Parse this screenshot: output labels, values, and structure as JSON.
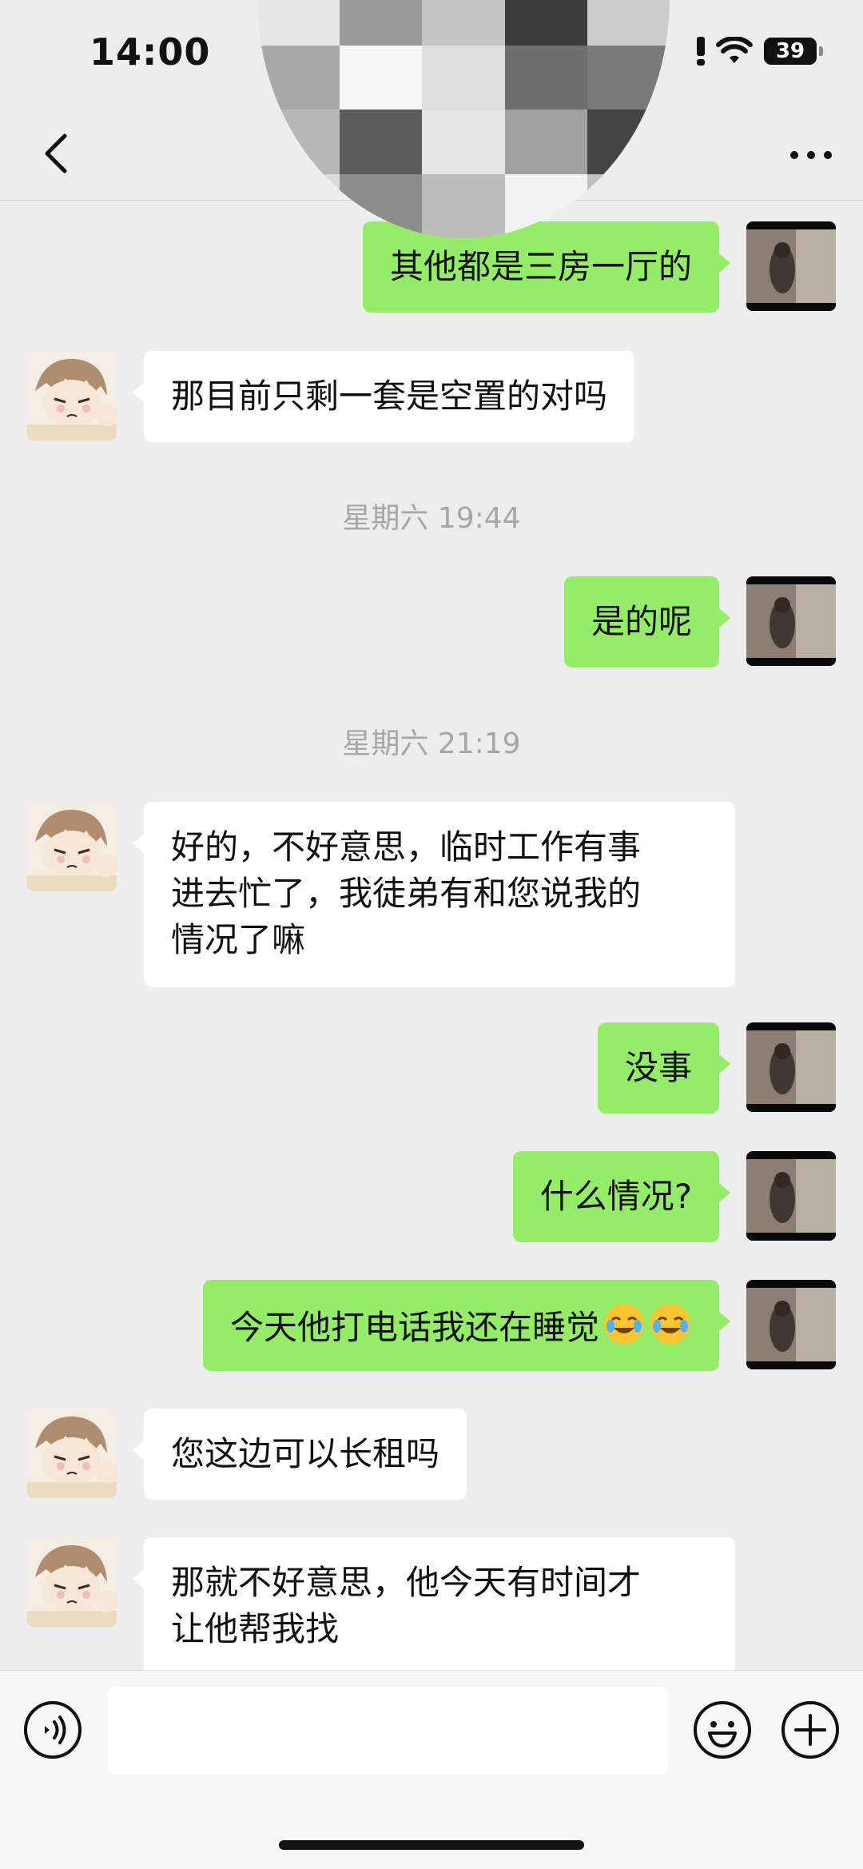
{
  "status": {
    "time": "14:00",
    "battery": "39"
  },
  "nav": {
    "back_icon": "chevron-left-icon",
    "more_icon": "more-dots-icon"
  },
  "colors": {
    "background": "#ededed",
    "sent_bubble": "#95ec69",
    "received_bubble": "#ffffff",
    "timestamp_text": "#a6a6a6"
  },
  "messages": [
    {
      "side": "right",
      "text": "其他都是三房一厅的"
    },
    {
      "side": "left",
      "text": "那目前只剩一套是空置的对吗"
    },
    {
      "type": "time",
      "text": "星期六 19:44"
    },
    {
      "side": "right",
      "text": "是的呢"
    },
    {
      "type": "time",
      "text": "星期六 21:19"
    },
    {
      "side": "left",
      "lines": [
        "好的，不好意思，临时工作有事",
        "进去忙了，我徒弟有和您说我的",
        "情况了嘛"
      ]
    },
    {
      "side": "right",
      "text": "没事"
    },
    {
      "side": "right",
      "text": "什么情况?"
    },
    {
      "side": "right",
      "text": "今天他打电话我还在睡觉",
      "emoji": [
        "crying-laughing-emoji",
        "crying-laughing-emoji"
      ]
    },
    {
      "side": "left",
      "text": "您这边可以长租吗"
    },
    {
      "side": "left",
      "lines": [
        "那就不好意思，他今天有时间才",
        "让他帮我找"
      ]
    }
  ],
  "input": {
    "voice_icon": "voice-icon",
    "emoji_icon": "emoji-icon",
    "plus_icon": "plus-icon",
    "placeholder": ""
  }
}
